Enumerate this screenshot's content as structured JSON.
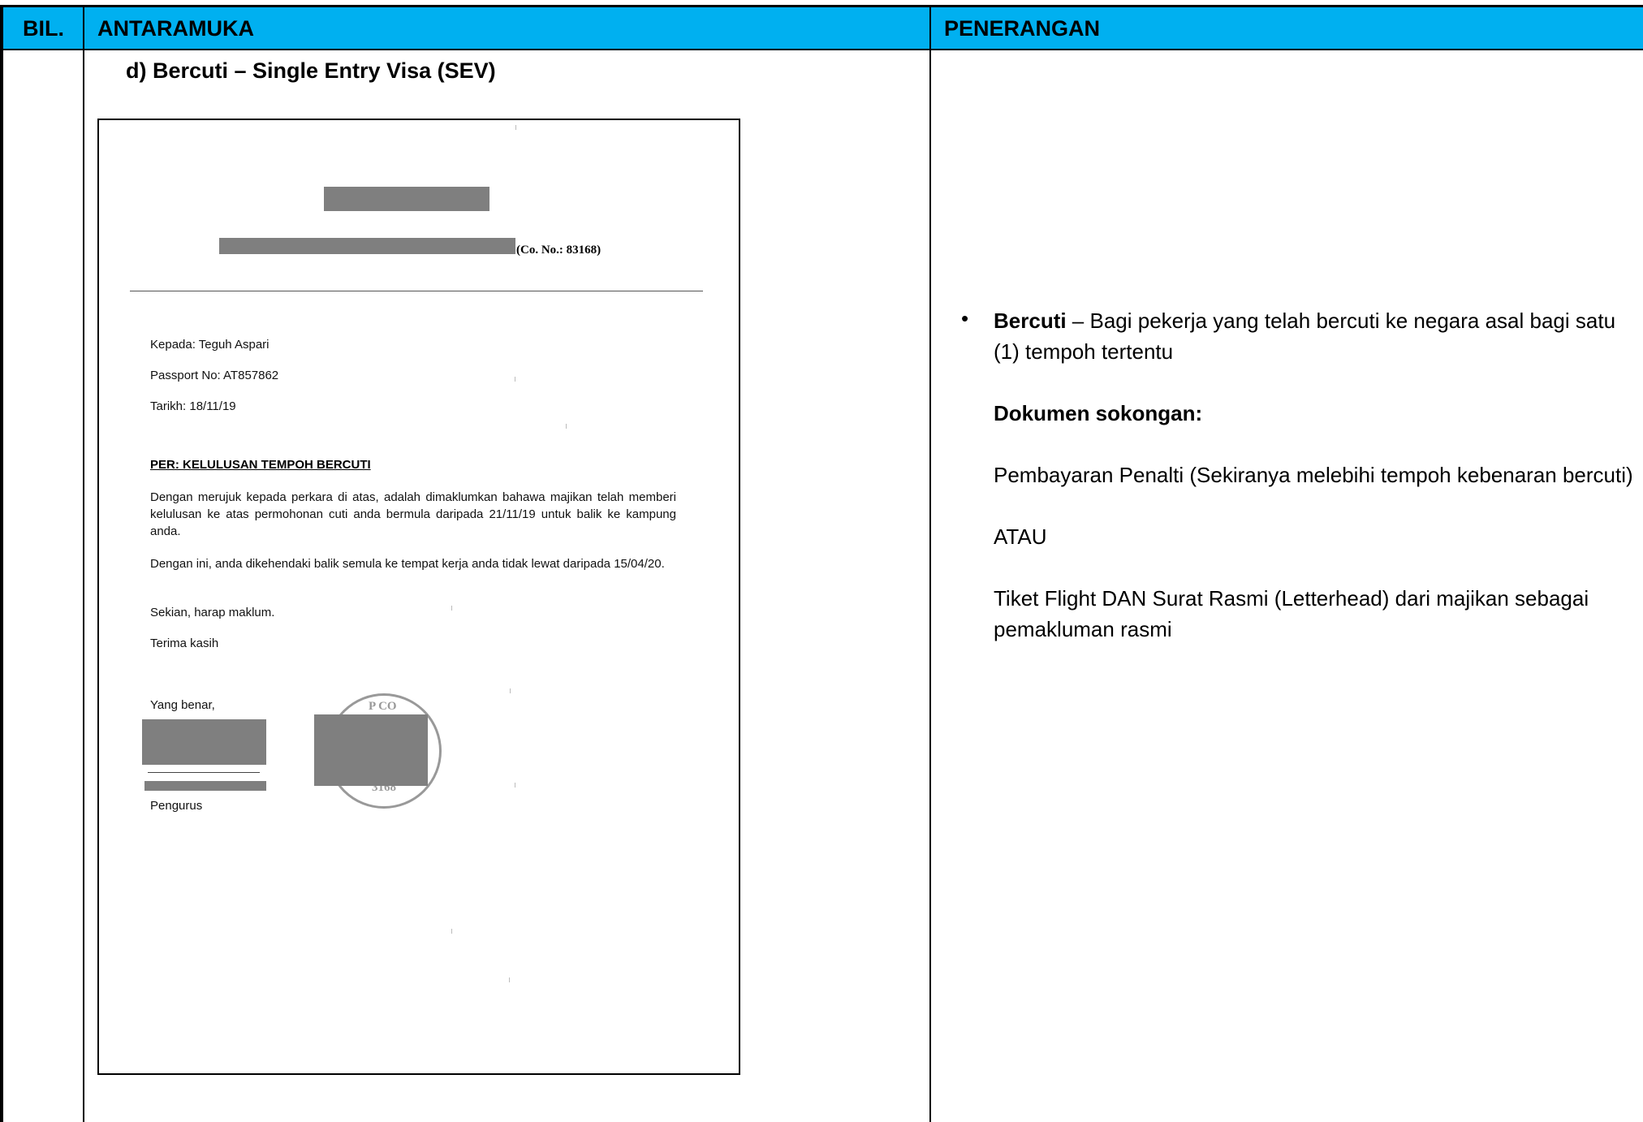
{
  "header": {
    "col_bil": "BIL.",
    "col_antaramuka": "ANTARAMUKA",
    "col_penerangan": "PENERANGAN",
    "background_color": "#00b0f0"
  },
  "section": {
    "subtitle": "d)  Bercuti – Single Entry Visa (SEV)"
  },
  "letter": {
    "company_no": "(Co. No.: 83168)",
    "to_line": "Kepada: Teguh Aspari",
    "passport_line": "Passport No: AT857862",
    "date_line": "Tarikh: 18/11/19",
    "subject": "PER: KELULUSAN TEMPOH BERCUTI",
    "para1": "Dengan merujuk kepada perkara di atas, adalah dimaklumkan bahawa majikan telah memberi kelulusan ke atas permohonan cuti anda bermula daripada 21/11/19 untuk balik ke kampung anda.",
    "para2": "Dengan ini, anda dikehendaki balik semula ke tempat kerja anda tidak lewat daripada 15/04/20.",
    "closing1": "Sekian, harap maklum.",
    "closing2": "Terima kasih",
    "sign_off": "Yang benar,",
    "position": "Pengurus",
    "stamp_top_text": "P CO",
    "stamp_bottom_text": "3168"
  },
  "description": {
    "bullet": "•",
    "term": "Bercuti",
    "term_desc": " – Bagi pekerja yang telah bercuti ke negara asal bagi satu (1) tempoh tertentu",
    "docs_heading": "Dokumen sokongan:",
    "option1": "Pembayaran Penalti (Sekiranya melebihi tempoh kebenaran bercuti)",
    "or_text": "ATAU",
    "option2": "Tiket Flight DAN Surat Rasmi (Letterhead) dari majikan sebagai pemakluman rasmi"
  }
}
